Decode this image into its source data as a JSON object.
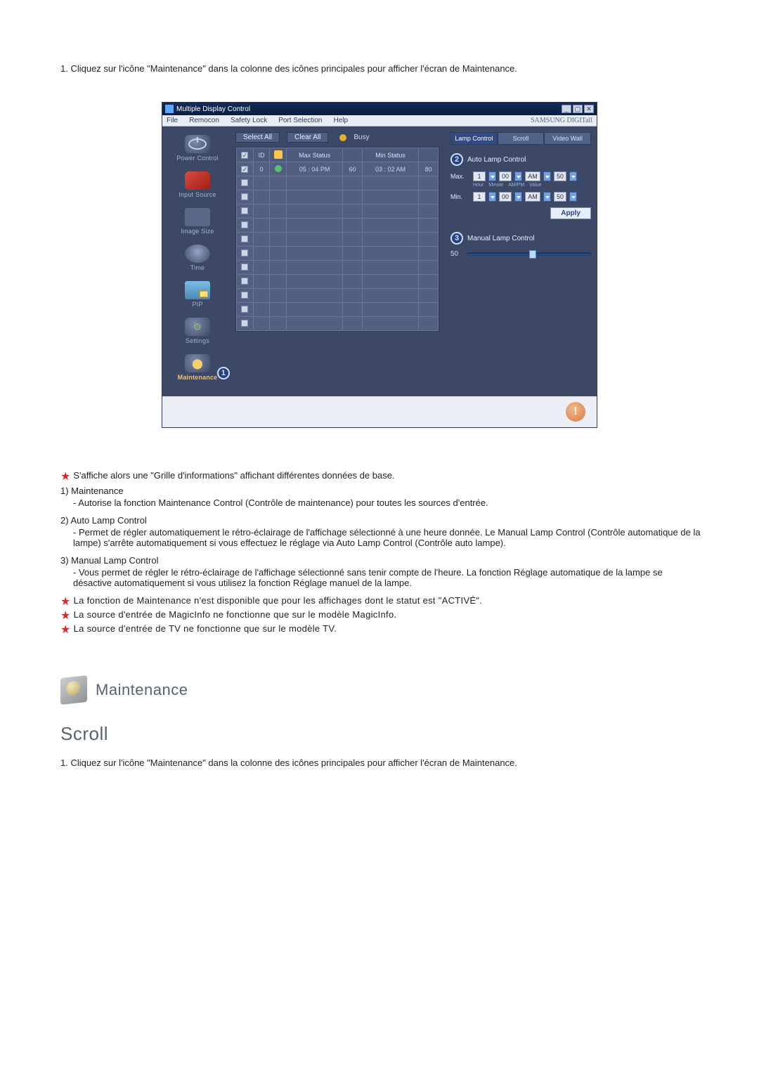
{
  "intro1": "1. Cliquez sur l'icône \"Maintenance\" dans la colonne des icônes principales pour afficher l'écran de Maintenance.",
  "titlebar": {
    "title": "Multiple Display Control"
  },
  "menubar": {
    "file": "File",
    "remocon": "Remocon",
    "safety": "Safety Lock",
    "port": "Port Selection",
    "help": "Help",
    "brand": "SAMSUNG DIGITall"
  },
  "nav": {
    "power": "Power Control",
    "input": "Input Source",
    "image": "Image Size",
    "time": "Time",
    "pip": "PIP",
    "settings": "Settings",
    "maintenance": "Maintenance",
    "badge1": "1"
  },
  "actions": {
    "selectAll": "Select All",
    "clearAll": "Clear All",
    "busy": "Busy"
  },
  "table": {
    "headers": {
      "chk": "☑",
      "id": "ID",
      "lamp": "⬤",
      "maxstatus": "Max Status",
      "maxv": "",
      "minstatus": "Min Status",
      "minv": ""
    },
    "row1": {
      "id": "0",
      "max": "05 : 04 PM",
      "maxv": "60",
      "min": "03 : 02 AM",
      "minv": "80"
    }
  },
  "tabs": {
    "lamp": "Lamp Control",
    "scroll": "Scroll",
    "video": "Video Wall"
  },
  "panel": {
    "autoTitle": "Auto Lamp Control",
    "n2": "2",
    "maxLbl": "Max.",
    "minLbl": "Min.",
    "f_hour": "Hour",
    "f_min": "Minute",
    "f_ampm": "AM/PM",
    "f_val": "Value",
    "max": {
      "h": "1",
      "m": "00",
      "ampm": "AM",
      "v": "50"
    },
    "min": {
      "h": "1",
      "m": "00",
      "ampm": "AM",
      "v": "50"
    },
    "apply": "Apply",
    "manualTitle": "Manual Lamp Control",
    "n3": "3",
    "sliderVal": "50"
  },
  "notes": {
    "star1": "S'affiche alors une \"Grille d'informations\" affichant différentes données de base.",
    "li1h": "1)  Maintenance",
    "li1b": "- Autorise la fonction Maintenance Control (Contrôle de maintenance) pour toutes les sources d'entrée.",
    "li2h": "2)  Auto Lamp Control",
    "li2b": "- Permet de régler automatiquement le rétro-éclairage de l'affichage sélectionné à une heure donnée. Le Manual Lamp Control (Contrôle automatique de la lampe) s'arrête automatiquement si vous effectuez le réglage via Auto Lamp Control (Contrôle auto lampe).",
    "li3h": "3)  Manual Lamp Control",
    "li3b": "- Vous permet de régler le rétro-éclairage de l'affichage sélectionné sans tenir compte de l'heure. La fonction Réglage automatique de la lampe se désactive automatiquement si vous utilisez la fonction Réglage manuel de la lampe.",
    "star2": "La fonction de Maintenance n'est disponible que pour les affichages dont le statut est \"ACTIVÉ\".",
    "star3": "La source d'entrée de MagicInfo ne fonctionne que sur le modèle MagicInfo.",
    "star4": "La source d'entrée de TV ne fonctionne que sur le modèle TV."
  },
  "section": {
    "maintenance": "Maintenance",
    "scroll": "Scroll"
  },
  "intro2": "1. Cliquez sur l'icône \"Maintenance\" dans la colonne des icônes principales pour afficher l'écran de Maintenance."
}
